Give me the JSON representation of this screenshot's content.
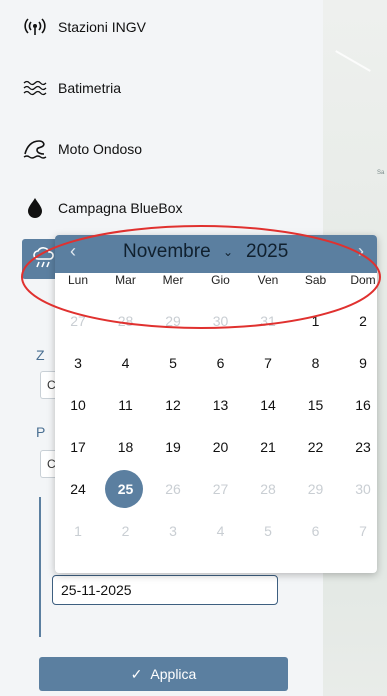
{
  "sidebar": {
    "items": [
      {
        "label": "Stazioni INGV",
        "icon": "antenna-icon"
      },
      {
        "label": "Batimetria",
        "icon": "waves-icon"
      },
      {
        "label": "Moto Ondoso",
        "icon": "wave-icon"
      },
      {
        "label": "Campagna BlueBox",
        "icon": "drop-icon"
      }
    ],
    "active_icon": "rain-cloud-icon",
    "label_z": "Z",
    "label_p": "P",
    "select_stub_1": "C",
    "select_stub_2": "C"
  },
  "map": {
    "label": "Sa"
  },
  "calendar": {
    "month": "Novembre",
    "year": "2025",
    "prev": "‹",
    "next": "›",
    "weekdays": [
      "Lun",
      "Mar",
      "Mer",
      "Gio",
      "Ven",
      "Sab",
      "Dom"
    ],
    "weeks": [
      [
        "27",
        "28",
        "29",
        "30",
        "31",
        "1",
        "2"
      ],
      [
        "3",
        "4",
        "5",
        "6",
        "7",
        "8",
        "9"
      ],
      [
        "10",
        "11",
        "12",
        "13",
        "14",
        "15",
        "16"
      ],
      [
        "17",
        "18",
        "19",
        "20",
        "21",
        "22",
        "23"
      ],
      [
        "24",
        "25",
        "26",
        "27",
        "28",
        "29",
        "30"
      ],
      [
        "1",
        "2",
        "3",
        "4",
        "5",
        "6",
        "7"
      ]
    ],
    "selected": "25"
  },
  "date_input": {
    "value": "25-11-2025"
  },
  "apply_button": {
    "label": "Applica"
  },
  "colors": {
    "accent": "#5b7fa0",
    "annotation": "#e0312f"
  }
}
